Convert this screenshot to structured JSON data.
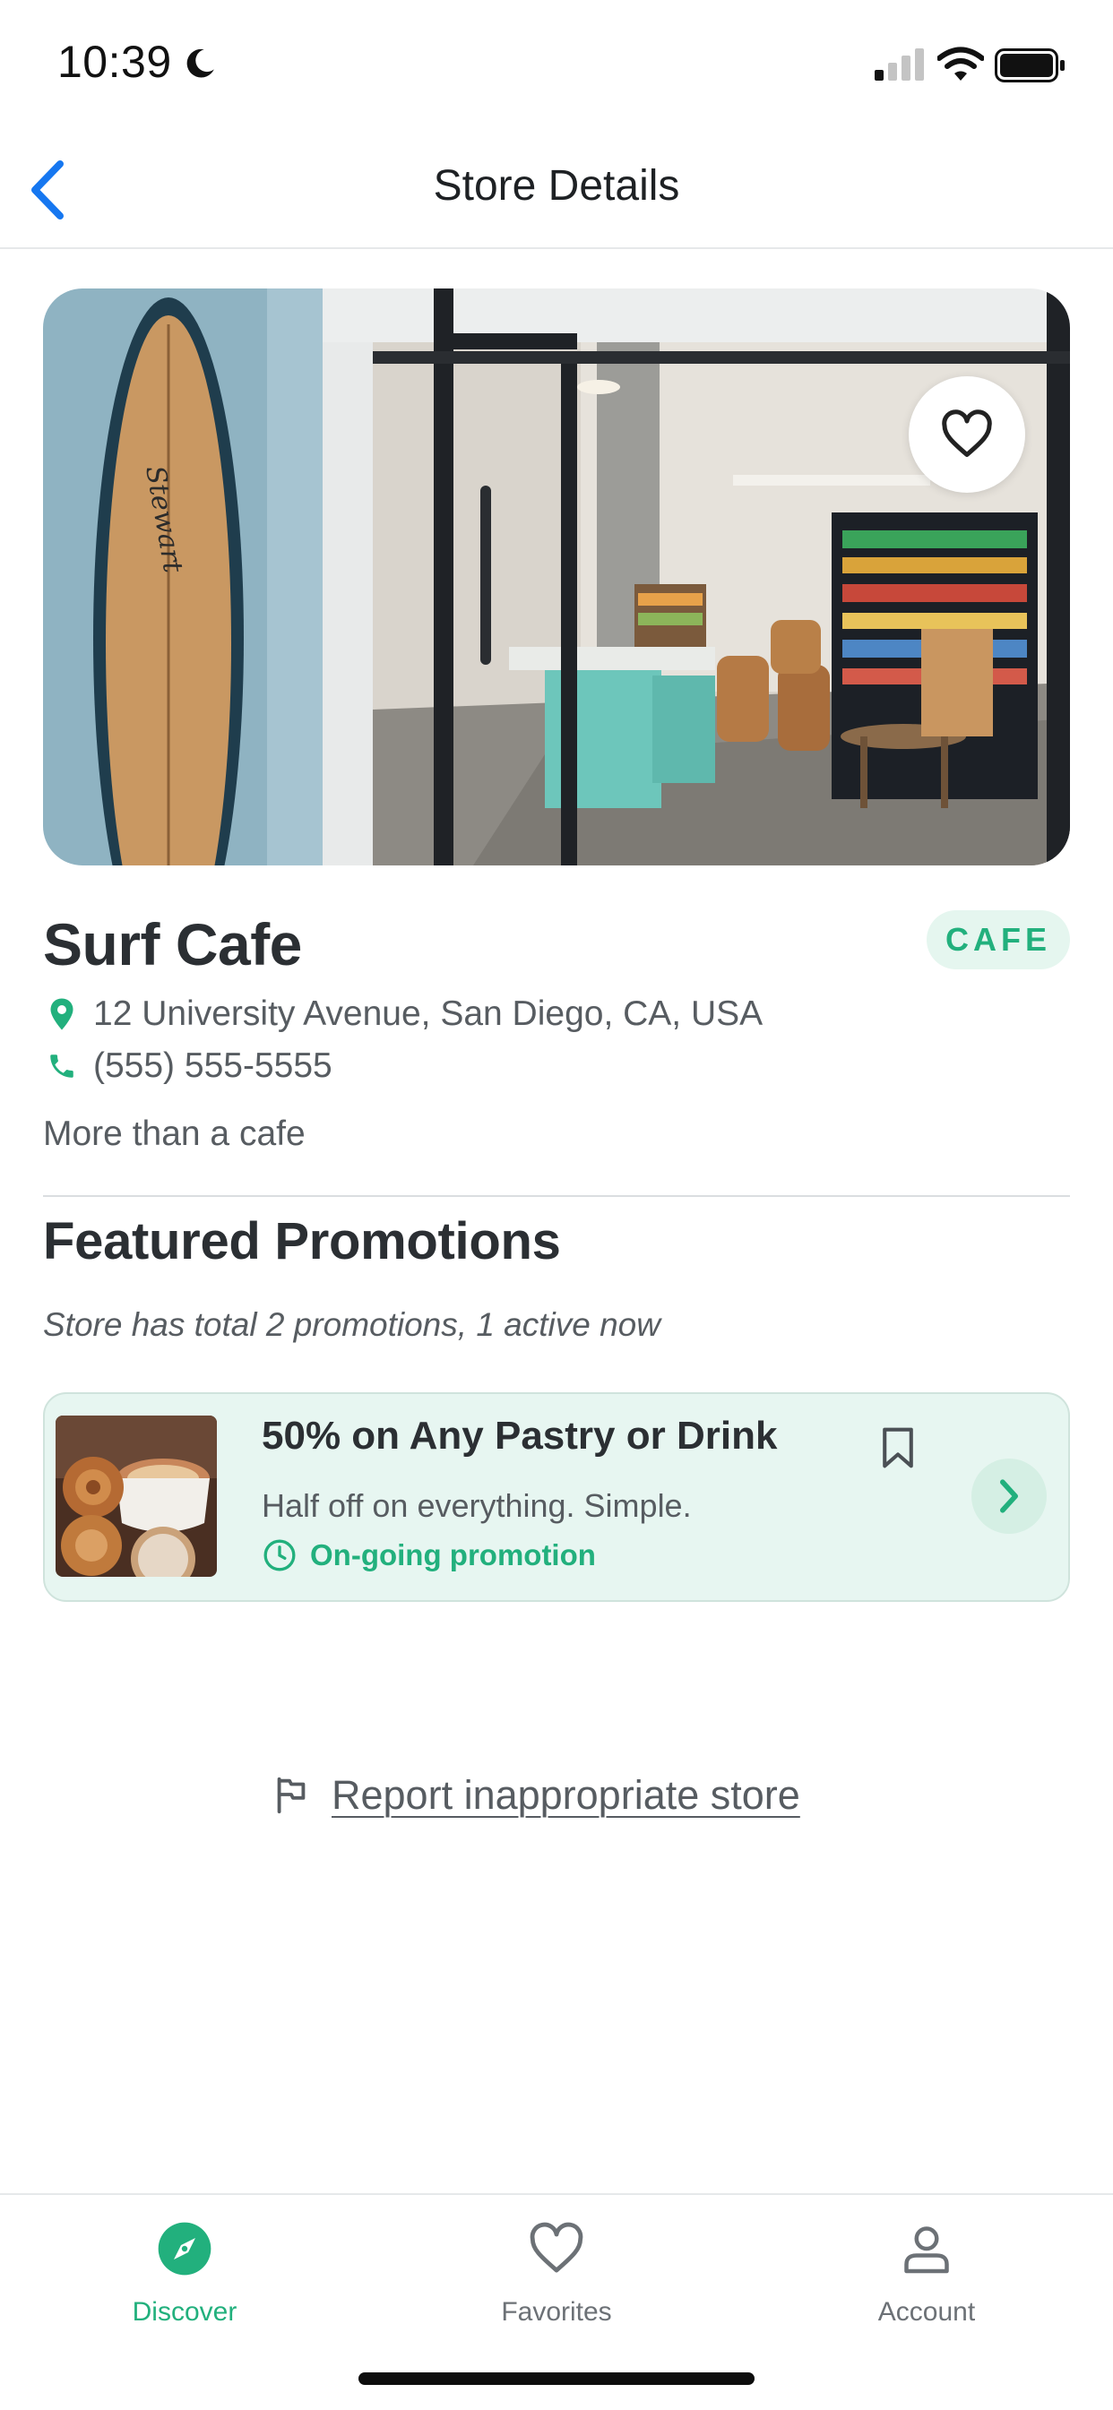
{
  "status_bar": {
    "time": "10:39"
  },
  "nav": {
    "title": "Store Details"
  },
  "store": {
    "name": "Surf Cafe",
    "category": "CAFE",
    "address": "12 University Avenue, San Diego, CA, USA",
    "phone": "(555) 555-5555",
    "description": "More than a cafe"
  },
  "promotions": {
    "section_title": "Featured Promotions",
    "summary": "Store has total 2 promotions, 1 active now",
    "items": [
      {
        "title": "50% on Any Pastry or Drink",
        "subtitle": "Half off on everything. Simple.",
        "status": "On-going promotion"
      }
    ]
  },
  "report": {
    "label": "Report inappropriate store"
  },
  "tab_bar": {
    "items": [
      {
        "label": "Discover",
        "icon": "compass-icon",
        "active": true
      },
      {
        "label": "Favorites",
        "icon": "heart-icon",
        "active": false
      },
      {
        "label": "Account",
        "icon": "person-icon",
        "active": false
      }
    ]
  },
  "colors": {
    "accent": "#22b07d",
    "back_blue": "#1677f0",
    "promo_bg": "#e7f6f1",
    "text_dark": "#2b2f33",
    "text_muted": "#575c61"
  }
}
